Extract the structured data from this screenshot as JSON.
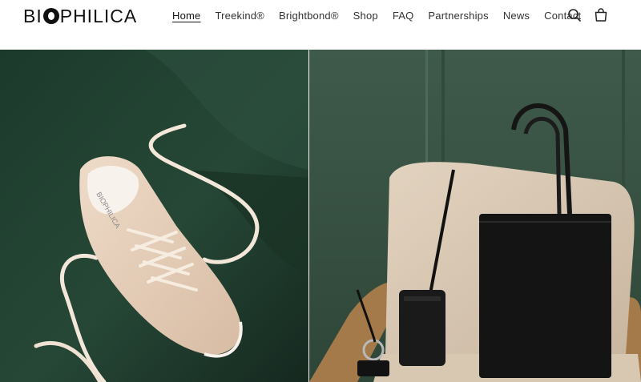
{
  "brand": {
    "logo_prefix": "BI",
    "logo_suffix": "PHILICA"
  },
  "nav": {
    "items": [
      {
        "label": "Home",
        "active": true
      },
      {
        "label": "Treekind®",
        "active": false
      },
      {
        "label": "Brightbond®",
        "active": false
      },
      {
        "label": "Shop",
        "active": false
      },
      {
        "label": "FAQ",
        "active": false
      },
      {
        "label": "Partnerships",
        "active": false
      },
      {
        "label": "News",
        "active": false
      },
      {
        "label": "Contact",
        "active": false
      }
    ]
  },
  "header_icons": {
    "search": "search-icon",
    "cart": "cart-icon"
  },
  "hero": {
    "left_image": "sneaker-photo",
    "right_image": "tote-bag-photo",
    "colors": {
      "left_bg": "#1f3a2e",
      "right_bg": "#3b5546"
    }
  }
}
